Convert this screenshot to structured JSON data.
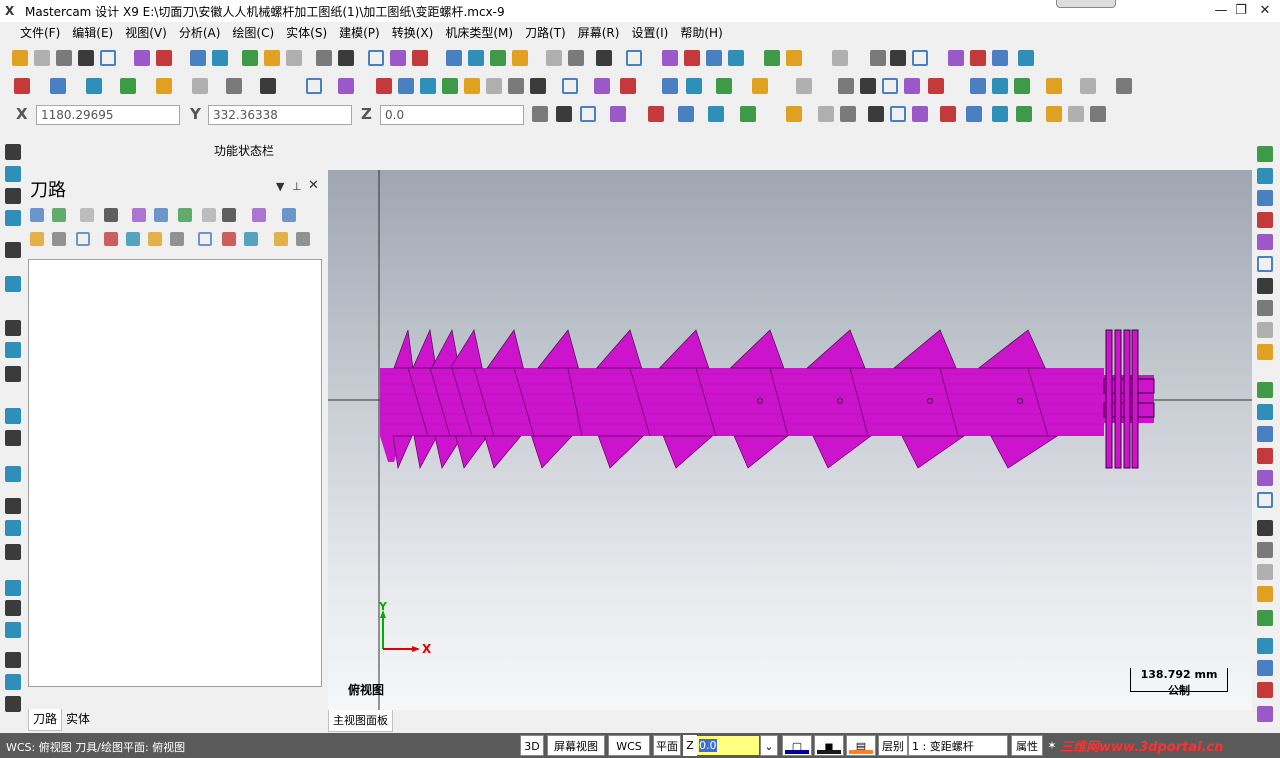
{
  "window": {
    "title": "Mastercam 设计 X9  E:\\切面刀\\安徽人人机械螺杆加工图纸(1)\\加工图纸\\变距螺杆.mcx-9",
    "minimize_glyph": "—",
    "restore_glyph": "❐",
    "close_glyph": "✕"
  },
  "menu": {
    "items": [
      "文件(F)",
      "编辑(E)",
      "视图(V)",
      "分析(A)",
      "绘图(C)",
      "实体(S)",
      "建模(P)",
      "转换(X)",
      "机床类型(M)",
      "刀路(T)",
      "屏幕(R)",
      "设置(I)",
      "帮助(H)"
    ]
  },
  "coords": {
    "x_label": "X",
    "x_value": "1180.29695",
    "y_label": "Y",
    "y_value": "332.36338",
    "z_label": "Z",
    "z_value": "0.0"
  },
  "function_bar": {
    "label": "功能状态栏"
  },
  "panel": {
    "title": "刀路",
    "tabs": [
      "刀路",
      "实体"
    ],
    "active_tab": "刀路"
  },
  "viewport": {
    "view_label": "俯视图",
    "scale_value": "138.792 mm",
    "scale_unit": "公制",
    "axis_y": "Y",
    "axis_x": "X",
    "part_color": "#cc14cc",
    "tab": "主视图面板"
  },
  "status": {
    "text": "WCS: 俯视图  刀具/绘图平面: 俯视图",
    "btn_3d": "3D",
    "btn_screen_view": "屏幕视图",
    "btn_wcs": "WCS",
    "btn_plane": "平面",
    "z_label": "Z",
    "z_value": "0.0",
    "layer_label": "层别",
    "layer_value": "1 : 变距螺杆",
    "attr_label": "属性",
    "watermark": "三维网www.3dportal.cn"
  },
  "colors": {
    "accent": "#4a7fc1",
    "status_bg": "#5a5a5a",
    "part": "#cc14cc"
  }
}
